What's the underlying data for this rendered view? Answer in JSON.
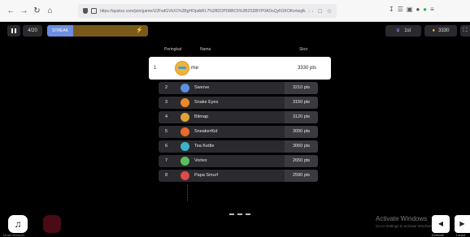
{
  "browser": {
    "url": "https://quizizz.com/join/game/U2FsdGVkX1%2BgHOpdkRL7%2B2OP0RBC5%2B2SDBYP0ADoQyN1KOKvrtwgMAr%3D",
    "nav_icons": [
      "back-icon",
      "forward-icon",
      "reload-icon",
      "home-icon"
    ]
  },
  "game_bar": {
    "question_count": "4/20",
    "streak_label": "STREAK",
    "streak_progress": 0.26,
    "rank_label": "1st",
    "score_label": "3330"
  },
  "leaderboard": {
    "headers": {
      "rank": "Peringkat",
      "name": "Nama",
      "score": "Skor"
    },
    "me": {
      "rank": "1",
      "name": "me",
      "score": "3330 pts"
    },
    "rows": [
      {
        "rank": "2",
        "name": "Swerve",
        "score": "3210 pts",
        "avatar_color": "#5b8fe0"
      },
      {
        "rank": "3",
        "name": "Snake Eyes",
        "score": "3150 pts",
        "avatar_color": "#e98a2a"
      },
      {
        "rank": "4",
        "name": "Bitmap",
        "score": "3120 pts",
        "avatar_color": "#e0a33a"
      },
      {
        "rank": "5",
        "name": "SneakerKid",
        "score": "3090 pts",
        "avatar_color": "#e96a2a"
      },
      {
        "rank": "6",
        "name": "Tea Kettle",
        "score": "3060 pts",
        "avatar_color": "#3fb0c9"
      },
      {
        "rank": "7",
        "name": "Vortex",
        "score": "2650 pts",
        "avatar_color": "#5bbf5a"
      },
      {
        "rank": "8",
        "name": "Papa Smurf",
        "score": "2590 pts",
        "avatar_color": "#e04a4a"
      }
    ]
  },
  "bottom": {
    "music_label": "Musik Bisukan",
    "activate_title": "Activate Windows",
    "activate_sub": "Go to Settings to activate Windows.",
    "prev_label": "Kembali",
    "next_label": "Lanjut"
  },
  "colors": {
    "background": "#000000",
    "row_bg": "#2b2b2f",
    "me_row_bg": "#ffffff",
    "streak_fill": "#6e8fe0",
    "streak_track": "#7a5a1a"
  }
}
